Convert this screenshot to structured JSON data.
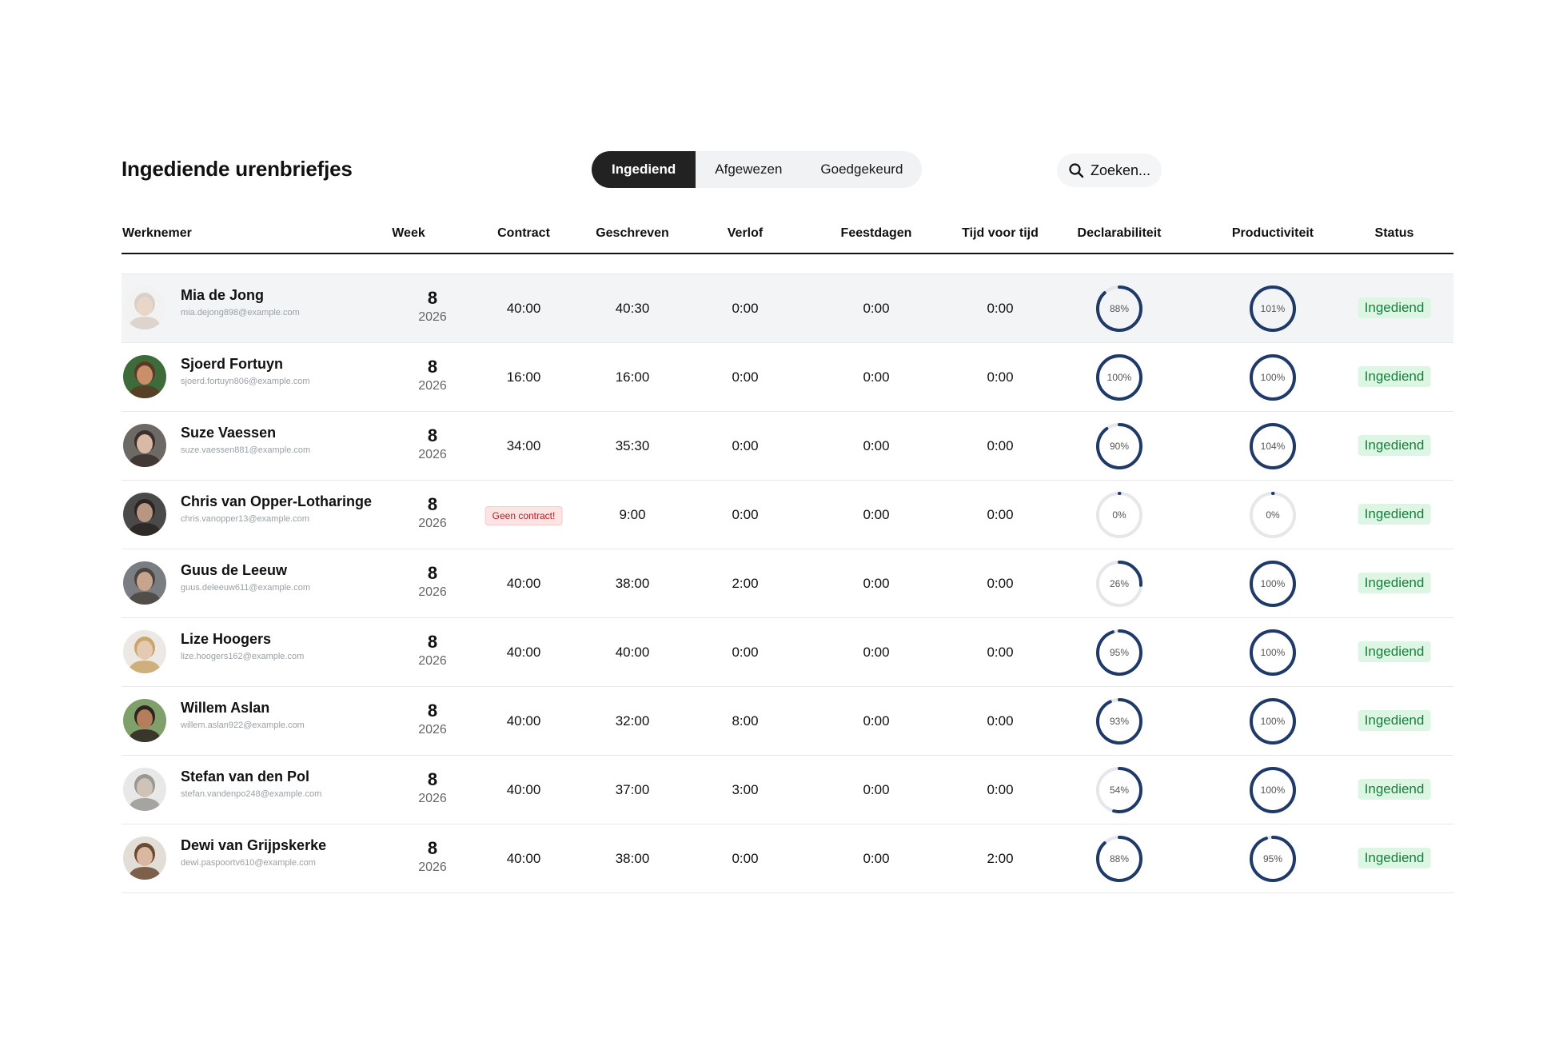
{
  "page": {
    "title": "Ingediende urenbriefjes"
  },
  "tabs": [
    {
      "label": "Ingediend",
      "active": true
    },
    {
      "label": "Afgewezen",
      "active": false
    },
    {
      "label": "Goedgekeurd",
      "active": false
    }
  ],
  "search": {
    "placeholder": "Zoeken...",
    "icon": "search-icon"
  },
  "colors": {
    "gauge": "#1f3a68",
    "gauge_track": "#e6e7ea",
    "status_bg": "#dcf6e3",
    "status_text": "#15803d",
    "alert_bg": "#fde4e4",
    "alert_text": "#b91c1c"
  },
  "table": {
    "columns": [
      "Werknemer",
      "Week",
      "Contract",
      "Geschreven",
      "Verlof",
      "Feestdagen",
      "Tijd voor tijd",
      "Declarabiliteit",
      "Productiviteit",
      "Status"
    ],
    "rows": [
      {
        "name": "Mia de Jong",
        "email": "mia.dejong898@example.com",
        "week": "8",
        "year": "2026",
        "contract": "40:00",
        "geschreven": "40:30",
        "verlof": "0:00",
        "feestdagen": "0:00",
        "tvt": "0:00",
        "declarabiliteit": 88,
        "declarabiliteit_label": "88%",
        "productiviteit": 101,
        "productiviteit_label": "101%",
        "status": "Ingediend",
        "highlight": true
      },
      {
        "name": "Sjoerd Fortuyn",
        "email": "sjoerd.fortuyn806@example.com",
        "week": "8",
        "year": "2026",
        "contract": "16:00",
        "geschreven": "16:00",
        "verlof": "0:00",
        "feestdagen": "0:00",
        "tvt": "0:00",
        "declarabiliteit": 100,
        "declarabiliteit_label": "100%",
        "productiviteit": 100,
        "productiviteit_label": "100%",
        "status": "Ingediend"
      },
      {
        "name": "Suze Vaessen",
        "email": "suze.vaessen881@example.com",
        "week": "8",
        "year": "2026",
        "contract": "34:00",
        "geschreven": "35:30",
        "verlof": "0:00",
        "feestdagen": "0:00",
        "tvt": "0:00",
        "declarabiliteit": 90,
        "declarabiliteit_label": "90%",
        "productiviteit": 104,
        "productiviteit_label": "104%",
        "status": "Ingediend"
      },
      {
        "name": "Chris van Opper-Lotharingen",
        "email": "chris.vanopper13@example.com",
        "week": "8",
        "year": "2026",
        "contract": "",
        "contract_alert": "Geen contract!",
        "geschreven": "9:00",
        "verlof": "0:00",
        "feestdagen": "0:00",
        "tvt": "0:00",
        "declarabiliteit": 0,
        "declarabiliteit_label": "0%",
        "productiviteit": 0,
        "productiviteit_label": "0%",
        "status": "Ingediend"
      },
      {
        "name": "Guus de Leeuw",
        "email": "guus.deleeuw611@example.com",
        "week": "8",
        "year": "2026",
        "contract": "40:00",
        "geschreven": "38:00",
        "verlof": "2:00",
        "feestdagen": "0:00",
        "tvt": "0:00",
        "declarabiliteit": 26,
        "declarabiliteit_label": "26%",
        "productiviteit": 100,
        "productiviteit_label": "100%",
        "status": "Ingediend"
      },
      {
        "name": "Lize Hoogers",
        "email": "lize.hoogers162@example.com",
        "week": "8",
        "year": "2026",
        "contract": "40:00",
        "geschreven": "40:00",
        "verlof": "0:00",
        "feestdagen": "0:00",
        "tvt": "0:00",
        "declarabiliteit": 95,
        "declarabiliteit_label": "95%",
        "productiviteit": 100,
        "productiviteit_label": "100%",
        "status": "Ingediend"
      },
      {
        "name": "Willem Aslan",
        "email": "willem.aslan922@example.com",
        "week": "8",
        "year": "2026",
        "contract": "40:00",
        "geschreven": "32:00",
        "verlof": "8:00",
        "feestdagen": "0:00",
        "tvt": "0:00",
        "declarabiliteit": 93,
        "declarabiliteit_label": "93%",
        "productiviteit": 100,
        "productiviteit_label": "100%",
        "status": "Ingediend"
      },
      {
        "name": "Stefan van den Pol",
        "email": "stefan.vandenpo248@example.com",
        "week": "8",
        "year": "2026",
        "contract": "40:00",
        "geschreven": "37:00",
        "verlof": "3:00",
        "feestdagen": "0:00",
        "tvt": "0:00",
        "declarabiliteit": 54,
        "declarabiliteit_label": "54%",
        "productiviteit": 100,
        "productiviteit_label": "100%",
        "status": "Ingediend"
      },
      {
        "name": "Dewi van Grijpskerke",
        "email": "dewi.paspoortv610@example.com",
        "week": "8",
        "year": "2026",
        "contract": "40:00",
        "geschreven": "38:00",
        "verlof": "0:00",
        "feestdagen": "0:00",
        "tvt": "2:00",
        "declarabiliteit": 88,
        "declarabiliteit_label": "88%",
        "productiviteit": 95,
        "productiviteit_label": "95%",
        "status": "Ingediend"
      }
    ]
  }
}
